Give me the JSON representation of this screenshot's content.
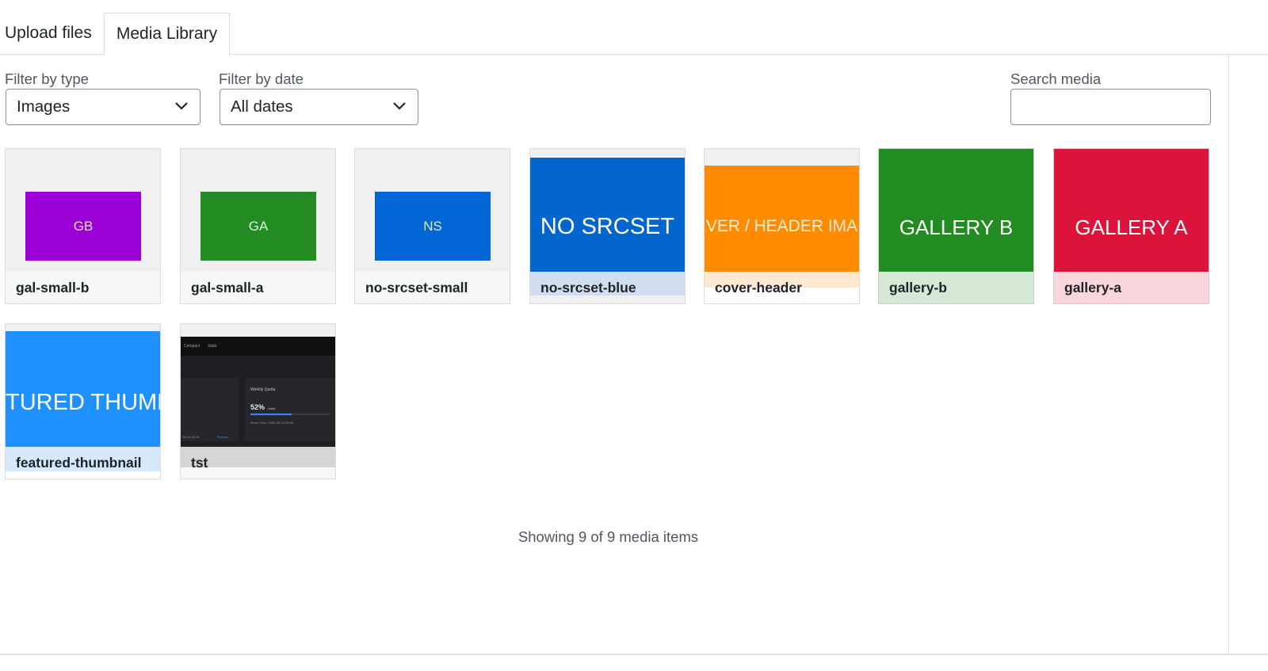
{
  "tabs": {
    "upload_label": "Upload files",
    "library_label": "Media Library"
  },
  "filters": {
    "type_label": "Filter by type",
    "type_value": "Images",
    "date_label": "Filter by date",
    "date_value": "All dates",
    "search_label": "Search media",
    "search_value": ""
  },
  "media": [
    {
      "name": "gal-small-b",
      "thumb_text": "GB",
      "color": "#9b00d4",
      "caption_bg": "#f6f7f7"
    },
    {
      "name": "gal-small-a",
      "thumb_text": "GA",
      "color": "#228b22",
      "caption_bg": "#f6f7f7"
    },
    {
      "name": "no-srcset-small",
      "thumb_text": "NS",
      "color": "#0366d6",
      "caption_bg": "#f6f7f7"
    },
    {
      "name": "no-srcset-blue",
      "thumb_text": "NO SRCSET",
      "color": "#0366cc",
      "caption_bg": "#d1def1"
    },
    {
      "name": "cover-header",
      "thumb_text": "VER / HEADER IMA",
      "color": "#ff8c00",
      "caption_bg": "#fde8d2"
    },
    {
      "name": "gallery-b",
      "thumb_text": "GALLERY B",
      "color": "#228b22",
      "caption_bg": "#d6e9d6"
    },
    {
      "name": "gallery-a",
      "thumb_text": "GALLERY A",
      "color": "#dc143c",
      "caption_bg": "#f8d6dc"
    },
    {
      "name": "featured-thumbnail",
      "thumb_text": "TURED THUMB",
      "color": "#1e90ff",
      "caption_bg": "#d6e8fb"
    },
    {
      "name": "tst",
      "thumb_text": "",
      "color": "#1e1f22",
      "caption_bg": "#d5d5d6"
    }
  ],
  "tst_preview": {
    "tab_a": "Compact",
    "tab_b": "Stats",
    "panel_title": "Weekly Quota",
    "percent": "52%",
    "percent_suffix": "Used",
    "quota_fraction": 0.52,
    "reset_text": "Reset Time: 2026-08-04 08:45",
    "footer_text": "08-04 08:30",
    "refresh_text": "Refresh"
  },
  "status": "Showing 9 of 9 media items"
}
